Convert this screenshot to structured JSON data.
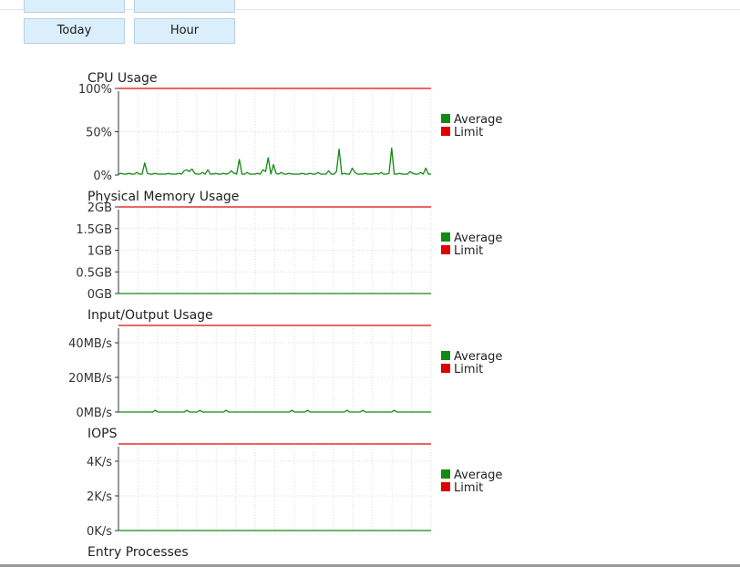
{
  "toolbar": {
    "today_label": "Today",
    "hour_label": "Hour"
  },
  "colors": {
    "average": "#138a13",
    "limit": "#e53030",
    "limit_legend": "#e00000",
    "grid": "#dcdcdc",
    "axis": "#333333"
  },
  "chart_data": [
    {
      "type": "line",
      "title": "CPU Usage",
      "ylim": [
        0,
        100
      ],
      "yticks": [
        0,
        50,
        100
      ],
      "yticklabels": [
        "0%",
        "50%",
        "100%"
      ],
      "x": [
        0,
        1,
        2,
        3,
        4,
        5,
        6,
        7,
        8,
        9,
        10,
        11,
        12,
        13,
        14,
        15,
        16,
        17,
        18,
        19,
        20,
        21,
        22,
        23,
        24,
        25,
        26,
        27,
        28,
        29,
        30,
        31,
        32,
        33,
        34,
        35,
        36,
        37,
        38,
        39,
        40,
        41,
        42,
        43,
        44,
        45,
        46,
        47,
        48,
        49,
        50,
        51,
        52,
        53,
        54,
        55,
        56,
        57,
        58,
        59,
        60,
        61,
        62,
        63,
        64,
        65,
        66,
        67,
        68,
        69,
        70,
        71,
        72,
        73,
        74,
        75,
        76,
        77,
        78,
        79,
        80,
        81,
        82,
        83,
        84,
        85,
        86,
        87,
        88,
        89,
        90,
        91,
        92,
        93,
        94,
        95,
        96,
        97,
        98,
        99,
        100,
        101,
        102,
        103,
        104,
        105,
        106,
        107,
        108,
        109,
        110,
        111,
        112,
        113,
        114,
        115,
        116,
        117,
        118,
        119
      ],
      "series": [
        {
          "name": "Average",
          "values": [
            1,
            2,
            1,
            1,
            2,
            1,
            1,
            3,
            1,
            1,
            14,
            2,
            1,
            1,
            2,
            1,
            1,
            1,
            1,
            2,
            1,
            1,
            1,
            2,
            1,
            5,
            6,
            4,
            7,
            2,
            1,
            1,
            3,
            1,
            6,
            1,
            1,
            2,
            1,
            1,
            2,
            1,
            2,
            5,
            2,
            1,
            18,
            1,
            1,
            3,
            1,
            1,
            1,
            2,
            1,
            6,
            4,
            20,
            1,
            12,
            2,
            1,
            3,
            1,
            1,
            2,
            1,
            1,
            1,
            1,
            2,
            1,
            1,
            2,
            1,
            1,
            3,
            1,
            1,
            1,
            5,
            1,
            1,
            4,
            30,
            1,
            2,
            1,
            1,
            8,
            3,
            1,
            1,
            1,
            2,
            1,
            1,
            1,
            2,
            1,
            3,
            1,
            1,
            2,
            31,
            1,
            1,
            2,
            1,
            1,
            1,
            4,
            2,
            1,
            1,
            3,
            1,
            8,
            1,
            1
          ]
        },
        {
          "name": "Limit",
          "values": [
            100,
            100
          ]
        }
      ]
    },
    {
      "type": "line",
      "title": "Physical Memory Usage",
      "ylim": [
        0,
        2
      ],
      "yticks": [
        0,
        0.5,
        1,
        1.5,
        2
      ],
      "yticklabels": [
        "0GB",
        "0.5GB",
        "1GB",
        "1.5GB",
        "2GB"
      ],
      "series": [
        {
          "name": "Average",
          "values": [
            0,
            0
          ]
        },
        {
          "name": "Limit",
          "values": [
            2,
            2
          ]
        }
      ]
    },
    {
      "type": "line",
      "title": "Input/Output Usage",
      "ylim": [
        0,
        50
      ],
      "yticks": [
        0,
        20,
        40
      ],
      "yticklabels": [
        "0MB/s",
        "20MB/s",
        "40MB/s"
      ],
      "series": [
        {
          "name": "Average",
          "values": [
            0,
            0,
            0,
            0,
            0,
            0,
            0,
            0,
            0,
            0,
            0,
            0,
            0,
            0,
            1,
            0,
            0,
            0,
            0,
            0,
            0,
            0,
            0,
            0,
            0,
            0,
            1,
            0,
            0,
            0,
            0,
            1,
            0,
            0,
            0,
            0,
            0,
            0,
            0,
            0,
            0,
            1,
            0,
            0,
            0,
            0,
            0,
            0,
            0,
            0,
            0,
            0,
            0,
            0,
            0,
            0,
            0,
            0,
            0,
            0,
            0,
            0,
            0,
            0,
            0,
            0,
            1,
            0,
            0,
            0,
            0,
            0,
            1,
            0,
            0,
            0,
            0,
            0,
            0,
            0,
            0,
            0,
            0,
            0,
            0,
            0,
            0,
            1,
            0,
            0,
            0,
            0,
            0,
            1,
            0,
            0,
            0,
            0,
            0,
            0,
            0,
            0,
            0,
            0,
            0,
            1,
            0,
            0,
            0,
            0,
            0,
            0,
            0,
            0,
            0,
            0,
            0,
            0,
            0,
            0
          ]
        },
        {
          "name": "Limit",
          "values": [
            50,
            50
          ]
        }
      ]
    },
    {
      "type": "line",
      "title": "IOPS",
      "ylim": [
        0,
        5000
      ],
      "yticks": [
        0,
        2000,
        4000
      ],
      "yticklabels": [
        "0K/s",
        "2K/s",
        "4K/s"
      ],
      "series": [
        {
          "name": "Average",
          "values": [
            0,
            0
          ]
        },
        {
          "name": "Limit",
          "values": [
            5000,
            5000
          ]
        }
      ]
    }
  ],
  "next_section_title": "Entry Processes"
}
